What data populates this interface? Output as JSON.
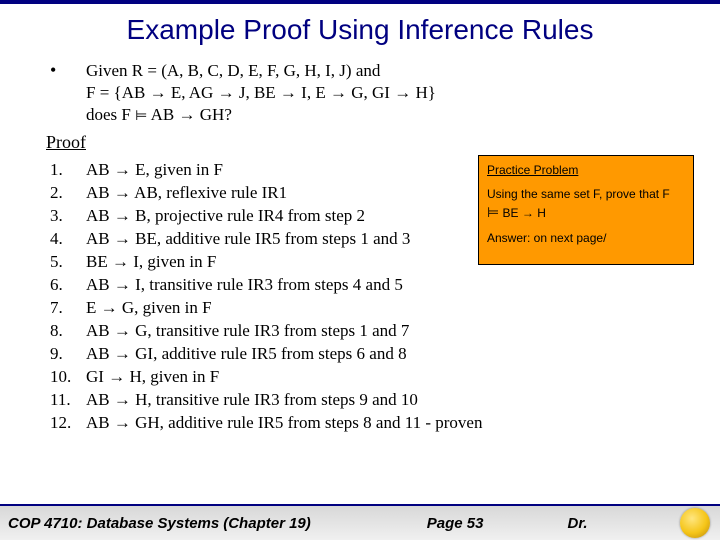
{
  "title": "Example Proof Using Inference Rules",
  "bullet": "•",
  "given": {
    "line1": "Given R = (A, B, C, D, E, F, G, H, I, J) and",
    "line2_pre": "F = {AB ",
    "line2_a": "→",
    "line2_b": " E, AG ",
    "line2_c": "→",
    "line2_d": " J, BE ",
    "line2_e": "→",
    "line2_f": " I, E ",
    "line2_g": "→",
    "line2_h": " G, GI ",
    "line2_i": "→",
    "line2_j": " H}",
    "line3_a": "does F ",
    "line3_ent": "⊨",
    "line3_b": " AB ",
    "line3_arr": "→",
    "line3_c": " GH?"
  },
  "proof_heading": "Proof",
  "steps": [
    {
      "n": "1.",
      "a": "AB ",
      "arr": "→",
      "b": " E, given in F"
    },
    {
      "n": "2.",
      "a": "AB ",
      "arr": "→",
      "b": " AB, reflexive rule IR1"
    },
    {
      "n": "3.",
      "a": "AB ",
      "arr": "→",
      "b": " B, projective rule IR4 from step 2"
    },
    {
      "n": "4.",
      "a": "AB ",
      "arr": "→",
      "b": " BE, additive rule IR5 from steps 1 and 3"
    },
    {
      "n": "5.",
      "a": "BE ",
      "arr": "→",
      "b": " I, given in F"
    },
    {
      "n": "6.",
      "a": "AB ",
      "arr": "→",
      "b": " I, transitive rule IR3 from steps 4 and 5"
    },
    {
      "n": "7.",
      "a": "E ",
      "arr": "→",
      "b": " G, given in F"
    },
    {
      "n": "8.",
      "a": "AB ",
      "arr": "→",
      "b": " G, transitive rule IR3 from steps 1 and 7"
    },
    {
      "n": "9.",
      "a": "AB ",
      "arr": "→",
      "b": " GI, additive rule IR5 from steps 6 and 8"
    },
    {
      "n": "10.",
      "a": "GI ",
      "arr": "→",
      "b": " H, given in F"
    },
    {
      "n": "11.",
      "a": "AB ",
      "arr": "→",
      "b": " H, transitive rule IR3 from steps 9 and 10"
    },
    {
      "n": "12.",
      "a": "AB ",
      "arr": "→",
      "b": " GH, additive rule IR5 from steps 8 and 11 - proven"
    }
  ],
  "callout": {
    "title": "Practice Problem",
    "p1a": "Using the same set F, prove that F ",
    "p1_ent": "⊨",
    "p1b": " BE ",
    "p1_arr": "→",
    "p1c": " H",
    "p2": "Answer: on next page/"
  },
  "footer": {
    "course": "COP 4710: Database Systems",
    "chapter": "  (Chapter 19)",
    "page": "Page 53",
    "dr": "Dr."
  }
}
